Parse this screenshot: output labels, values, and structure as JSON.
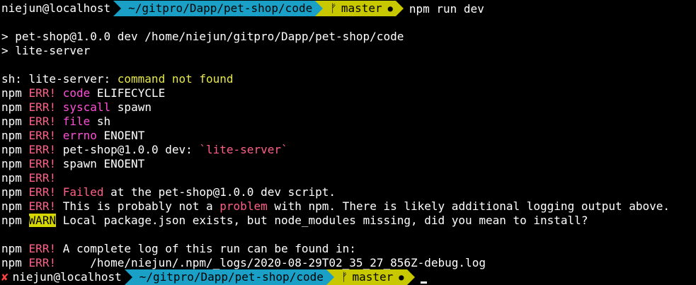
{
  "prompt1": {
    "user_host": "niejun@localhost",
    "dir": "~/gitpro/Dapp/pet-shop/code",
    "branch": "master",
    "command": "npm run dev"
  },
  "output": {
    "script_line": "> pet-shop@1.0.0 dev /home/niejun/gitpro/Dapp/pet-shop/code",
    "cmd_line": "> lite-server",
    "sh_prefix": "sh: lite-server: ",
    "sh_error": "command not found",
    "npm": "npm",
    "err_tag": "ERR!",
    "warn_tag": "WARN",
    "code_key": "code",
    "code_val": "ELIFECYCLE",
    "syscall_key": "syscall",
    "syscall_val": "spawn",
    "file_key": "file",
    "file_val": "sh",
    "errno_key": "errno",
    "errno_val": "ENOENT",
    "pkg_dev": "pet-shop@1.0.0 dev: ",
    "pkg_script": "`lite-server`",
    "spawn_line": "spawn ENOENT",
    "failed_word": "Failed",
    "failed_rest": " at the pet-shop@1.0.0 dev script.",
    "problem_pre": "This is probably not a ",
    "problem_word": "problem",
    "problem_post": " with npm. There is likely additional logging output above.",
    "warn_text": "Local package.json exists, but node_modules missing, did you mean to install?",
    "log_line": "A complete log of this run can be found in:",
    "log_path": "    /home/niejun/.npm/_logs/2020-08-29T02_35_27_856Z-debug.log"
  },
  "prompt2": {
    "status_icon": "✘",
    "user_host": "niejun@localhost",
    "dir": "~/gitpro/Dapp/pet-shop/code",
    "branch": "master"
  },
  "icons": {
    "branch": "git-branch-icon",
    "dirty": "dirty-dot-icon",
    "failed": "cross-icon"
  },
  "colors": {
    "background": "#000000",
    "dir_segment": "#1aa0c6",
    "git_segment": "#c8c800",
    "err": "#ff5f87",
    "magenta": "#ff4fd8",
    "yellow": "#e8e84a"
  }
}
